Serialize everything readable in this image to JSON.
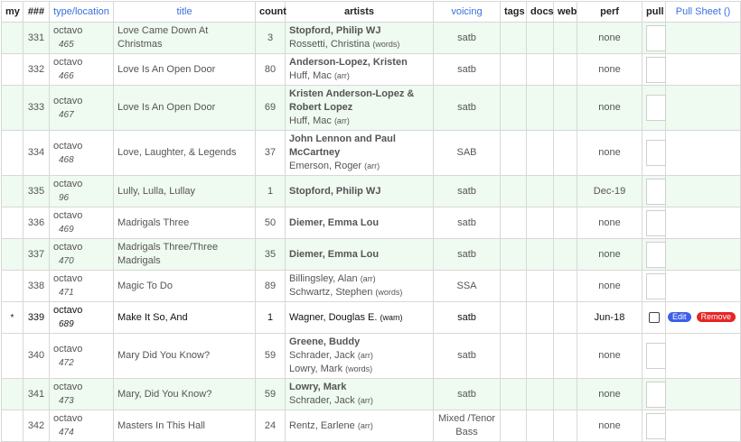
{
  "columns": {
    "my": "my",
    "num": "###",
    "type_location": "type/location",
    "title": "title",
    "count": "count",
    "artists": "artists",
    "voicing": "voicing",
    "tags": "tags",
    "docs": "docs",
    "web": "web",
    "perf": "perf",
    "pull": "pull",
    "pull_sheet": "Pull Sheet ()"
  },
  "rows": [
    {
      "my": "",
      "num": "331",
      "type": "octavo",
      "loc": "465",
      "title": "Love Came Down At Christmas",
      "count": "3",
      "artists": [
        {
          "name": "Stopford, Philip WJ",
          "role": "",
          "primary": true
        },
        {
          "name": "Rossetti, Christina",
          "role": "(words)",
          "primary": false
        }
      ],
      "voicing": "satb",
      "perf": "none",
      "pull": "box",
      "actions": false
    },
    {
      "my": "",
      "num": "332",
      "type": "octavo",
      "loc": "466",
      "title": "Love Is An Open Door",
      "count": "80",
      "artists": [
        {
          "name": "Anderson-Lopez, Kristen",
          "role": "",
          "primary": true
        },
        {
          "name": "Huff, Mac",
          "role": "(arr)",
          "primary": false
        }
      ],
      "voicing": "satb",
      "perf": "none",
      "pull": "box",
      "actions": false
    },
    {
      "my": "",
      "num": "333",
      "type": "octavo",
      "loc": "467",
      "title": "Love Is An Open Door",
      "count": "69",
      "artists": [
        {
          "name": "Kristen Anderson-Lopez & Robert Lopez",
          "role": "",
          "primary": true
        },
        {
          "name": "Huff, Mac",
          "role": "(arr)",
          "primary": false
        }
      ],
      "voicing": "satb",
      "perf": "none",
      "pull": "box",
      "actions": false
    },
    {
      "my": "",
      "num": "334",
      "type": "octavo",
      "loc": "468",
      "title": "Love, Laughter, & Legends",
      "count": "37",
      "artists": [
        {
          "name": "John Lennon and Paul McCartney",
          "role": "",
          "primary": true
        },
        {
          "name": "Emerson, Roger",
          "role": "(arr)",
          "primary": false
        }
      ],
      "voicing": "SAB",
      "perf": "none",
      "pull": "box",
      "actions": false
    },
    {
      "my": "",
      "num": "335",
      "type": "octavo",
      "loc": "96",
      "title": "Lully, Lulla, Lullay",
      "count": "1",
      "artists": [
        {
          "name": "Stopford, Philip WJ",
          "role": "",
          "primary": true
        }
      ],
      "voicing": "satb",
      "perf": "Dec-19",
      "pull": "box",
      "actions": false
    },
    {
      "my": "",
      "num": "336",
      "type": "octavo",
      "loc": "469",
      "title": "Madrigals Three",
      "count": "50",
      "artists": [
        {
          "name": "Diemer, Emma Lou",
          "role": "",
          "primary": true
        }
      ],
      "voicing": "satb",
      "perf": "none",
      "pull": "box",
      "actions": false
    },
    {
      "my": "",
      "num": "337",
      "type": "octavo",
      "loc": "470",
      "title": "Madrigals Three/Three Madrigals",
      "count": "35",
      "artists": [
        {
          "name": "Diemer, Emma Lou",
          "role": "",
          "primary": true
        }
      ],
      "voicing": "satb",
      "perf": "none",
      "pull": "box",
      "actions": false
    },
    {
      "my": "",
      "num": "338",
      "type": "octavo",
      "loc": "471",
      "title": "Magic To Do",
      "count": "89",
      "artists": [
        {
          "name": "Billingsley, Alan",
          "role": "(arr)",
          "primary": false
        },
        {
          "name": "Schwartz, Stephen",
          "role": "(words)",
          "primary": false
        }
      ],
      "voicing": "SSA",
      "perf": "none",
      "pull": "box",
      "actions": false
    },
    {
      "my": "*",
      "num": "339",
      "type": "octavo",
      "loc": "689",
      "title": "Make It So, And",
      "count": "1",
      "artists": [
        {
          "name": "Wagner, Douglas E.",
          "role": "(wam)",
          "primary": false
        }
      ],
      "voicing": "satb",
      "perf": "Jun-18",
      "perf_link": true,
      "pull": "check",
      "actions": true,
      "current": true
    },
    {
      "my": "",
      "num": "340",
      "type": "octavo",
      "loc": "472",
      "title": "Mary Did You Know?",
      "count": "59",
      "artists": [
        {
          "name": "Greene, Buddy",
          "role": "",
          "primary": true
        },
        {
          "name": "Schrader, Jack",
          "role": "(arr)",
          "primary": false
        },
        {
          "name": "Lowry, Mark",
          "role": "(words)",
          "primary": false
        }
      ],
      "voicing": "satb",
      "perf": "none",
      "pull": "box",
      "actions": false
    },
    {
      "my": "",
      "num": "341",
      "type": "octavo",
      "loc": "473",
      "title": "Mary, Did You Know?",
      "count": "59",
      "artists": [
        {
          "name": "Lowry, Mark",
          "role": "",
          "primary": true
        },
        {
          "name": "Schrader, Jack",
          "role": "(arr)",
          "primary": false
        }
      ],
      "voicing": "satb",
      "perf": "none",
      "pull": "box",
      "actions": false
    },
    {
      "my": "",
      "num": "342",
      "type": "octavo",
      "loc": "474",
      "title": "Masters In This Hall",
      "count": "24",
      "artists": [
        {
          "name": "Rentz, Earlene",
          "role": "(arr)",
          "primary": false
        }
      ],
      "voicing": "Mixed /Tenor Bass",
      "perf": "none",
      "pull": "box",
      "actions": false
    }
  ],
  "buttons": {
    "edit": "Edit",
    "remove": "Remove"
  },
  "colors": {
    "row_alt": "#effaf0",
    "link": "#3b6fe0",
    "edit": "#3c5fe8",
    "remove": "#e52525"
  }
}
